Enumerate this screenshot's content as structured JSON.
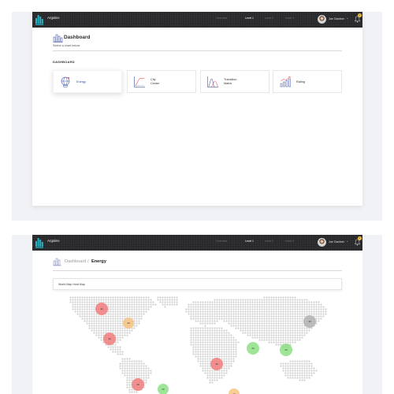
{
  "app": {
    "name": "Argaleo"
  },
  "nav": {
    "items": [
      "Overview",
      "Level 1",
      "Level 2",
      "Level 3"
    ],
    "active_index": 1
  },
  "user": {
    "name": "Joe Gardner",
    "notifications": "2"
  },
  "dashboard": {
    "title": "Dashboard",
    "subtitle": "Select a chart below",
    "section_label": "DASHBOARD",
    "cards": [
      {
        "label": "Energy",
        "icon": "globe-icon",
        "selected": true
      },
      {
        "label": "City\nCenter",
        "icon": "line-chart-icon",
        "selected": false
      },
      {
        "label": "Transition\nMatrix",
        "icon": "area-chart-icon",
        "selected": false
      },
      {
        "label": "Rating",
        "icon": "bar-trend-icon",
        "selected": false
      }
    ]
  },
  "energy": {
    "breadcrumb_root": "Dashboard",
    "breadcrumb_separator": "/",
    "breadcrumb_current": "Energy",
    "map_title": "World Map Heat Map",
    "hotspots": [
      {
        "label": "30",
        "color": "#f26d6d"
      },
      {
        "label": "20",
        "color": "#f7bd72"
      },
      {
        "label": "30",
        "color": "#f26d6d"
      },
      {
        "label": "30",
        "color": "#f26d6d"
      },
      {
        "label": "30",
        "color": "#f26d6d"
      },
      {
        "label": "20",
        "color": "#7ddc74"
      },
      {
        "label": "20",
        "color": "#7ddc74"
      },
      {
        "label": "20",
        "color": "#7ddc74"
      },
      {
        "label": "30",
        "color": "#a9a9a9"
      },
      {
        "label": "20",
        "color": "#f7bd72"
      }
    ]
  },
  "colors": {
    "brand": "#23b3c5",
    "accent": "#3c4fa6",
    "topbar": "#2a2a2c",
    "badge": "#f3c13b"
  }
}
